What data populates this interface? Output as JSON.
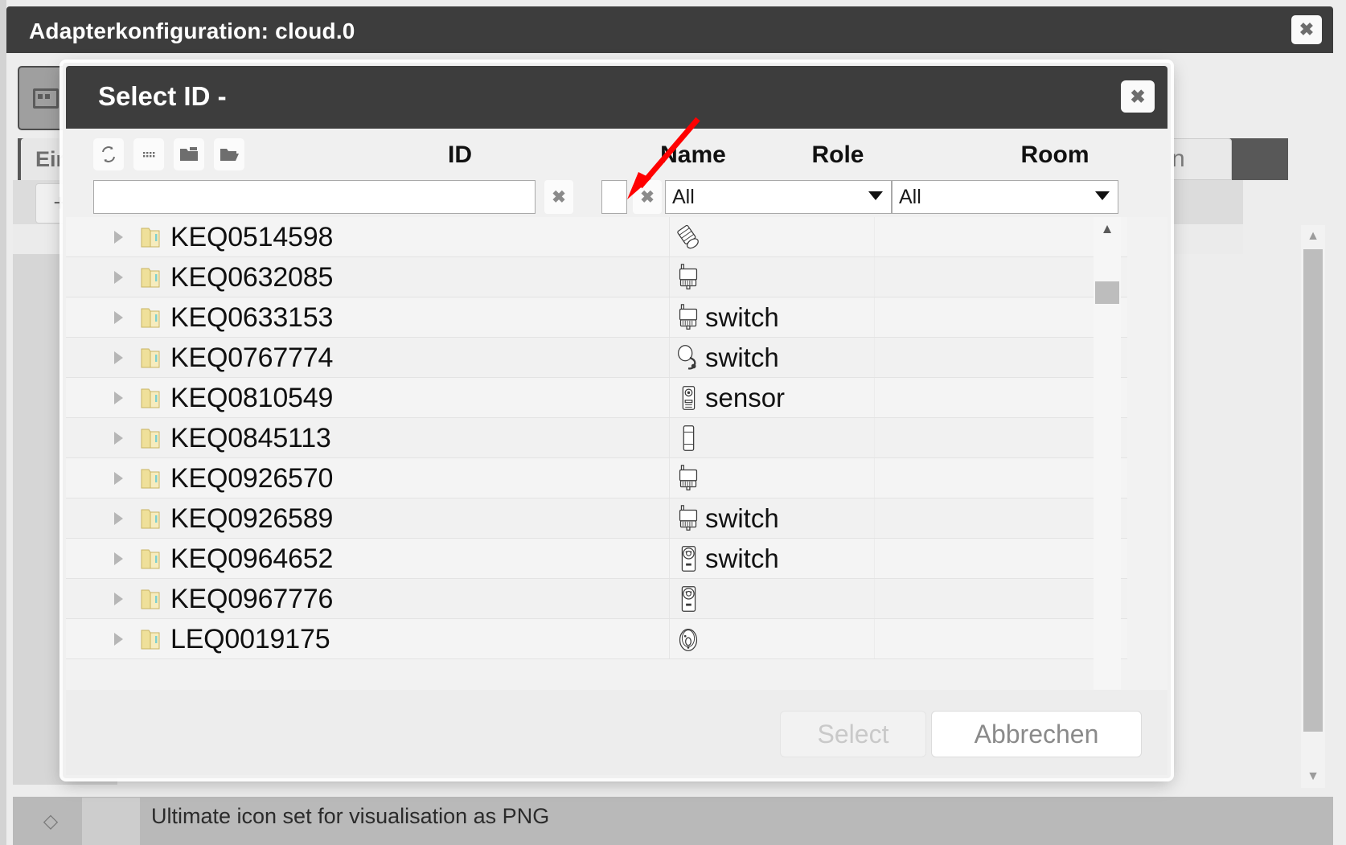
{
  "adapter_window": {
    "title": "Adapterkonfiguration: cloud.0",
    "close_icon": "close-icon",
    "tab_active_label": "Ein",
    "tab_right_label": "en",
    "add_button_label": "+",
    "bottom_text": "Ultimate icon set for visualisation as PNG"
  },
  "modal": {
    "title": "Select ID -",
    "close_icon": "close-icon",
    "toolbar": [
      {
        "name": "refresh-icon",
        "title": "refresh"
      },
      {
        "name": "list-icon",
        "title": "list"
      },
      {
        "name": "folder-closed-icon",
        "title": "collapse all"
      },
      {
        "name": "folder-open-icon",
        "title": "expand all"
      }
    ],
    "columns": [
      {
        "key": "id",
        "label": "ID"
      },
      {
        "key": "name",
        "label": "Name"
      },
      {
        "key": "role",
        "label": "Role"
      },
      {
        "key": "room",
        "label": "Room"
      }
    ],
    "filters": {
      "id_value": "",
      "id_placeholder": "",
      "name_value": "",
      "name_placeholder": "",
      "role_value": "All",
      "room_value": "All",
      "clear_icon": "clear-icon"
    },
    "rows": [
      {
        "id": "KEQ0514598",
        "name": "",
        "role": "",
        "room": "",
        "icon": "device-dimmer-icon"
      },
      {
        "id": "KEQ0632085",
        "name": "",
        "role": "",
        "room": "",
        "icon": "device-actuator-icon"
      },
      {
        "id": "KEQ0633153",
        "name": "",
        "role": "switch",
        "room": "",
        "icon": "device-actuator-icon"
      },
      {
        "id": "KEQ0767774",
        "name": "",
        "role": "switch",
        "room": "",
        "icon": "device-remote-icon"
      },
      {
        "id": "KEQ0810549",
        "name": "",
        "role": "sensor",
        "room": "",
        "icon": "device-sensor-icon"
      },
      {
        "id": "KEQ0845113",
        "name": "",
        "role": "",
        "room": "",
        "icon": "device-plain-icon"
      },
      {
        "id": "KEQ0926570",
        "name": "",
        "role": "",
        "room": "",
        "icon": "device-actuator-icon"
      },
      {
        "id": "KEQ0926589",
        "name": "",
        "role": "switch",
        "room": "",
        "icon": "device-actuator-icon"
      },
      {
        "id": "KEQ0964652",
        "name": "",
        "role": "switch",
        "room": "",
        "icon": "device-socket-icon"
      },
      {
        "id": "KEQ0967776",
        "name": "",
        "role": "",
        "room": "",
        "icon": "device-socket-icon"
      },
      {
        "id": "LEQ0019175",
        "name": "",
        "role": "",
        "room": "",
        "icon": "device-smoke-icon"
      }
    ],
    "footer": {
      "select_label": "Select",
      "select_disabled": true,
      "cancel_label": "Abbrechen"
    },
    "scroll": {
      "h_thumb_percent": 86,
      "v_thumb_percent": 12
    }
  },
  "annotation": {
    "arrow_color": "#ff0000",
    "points_to": "name-filter-input"
  },
  "colors": {
    "titlebar": "#3d3d3d",
    "dialog_bg": "#f0f0f0",
    "accent_red": "#ff0000",
    "folder_yellow": "#f3de8a"
  }
}
